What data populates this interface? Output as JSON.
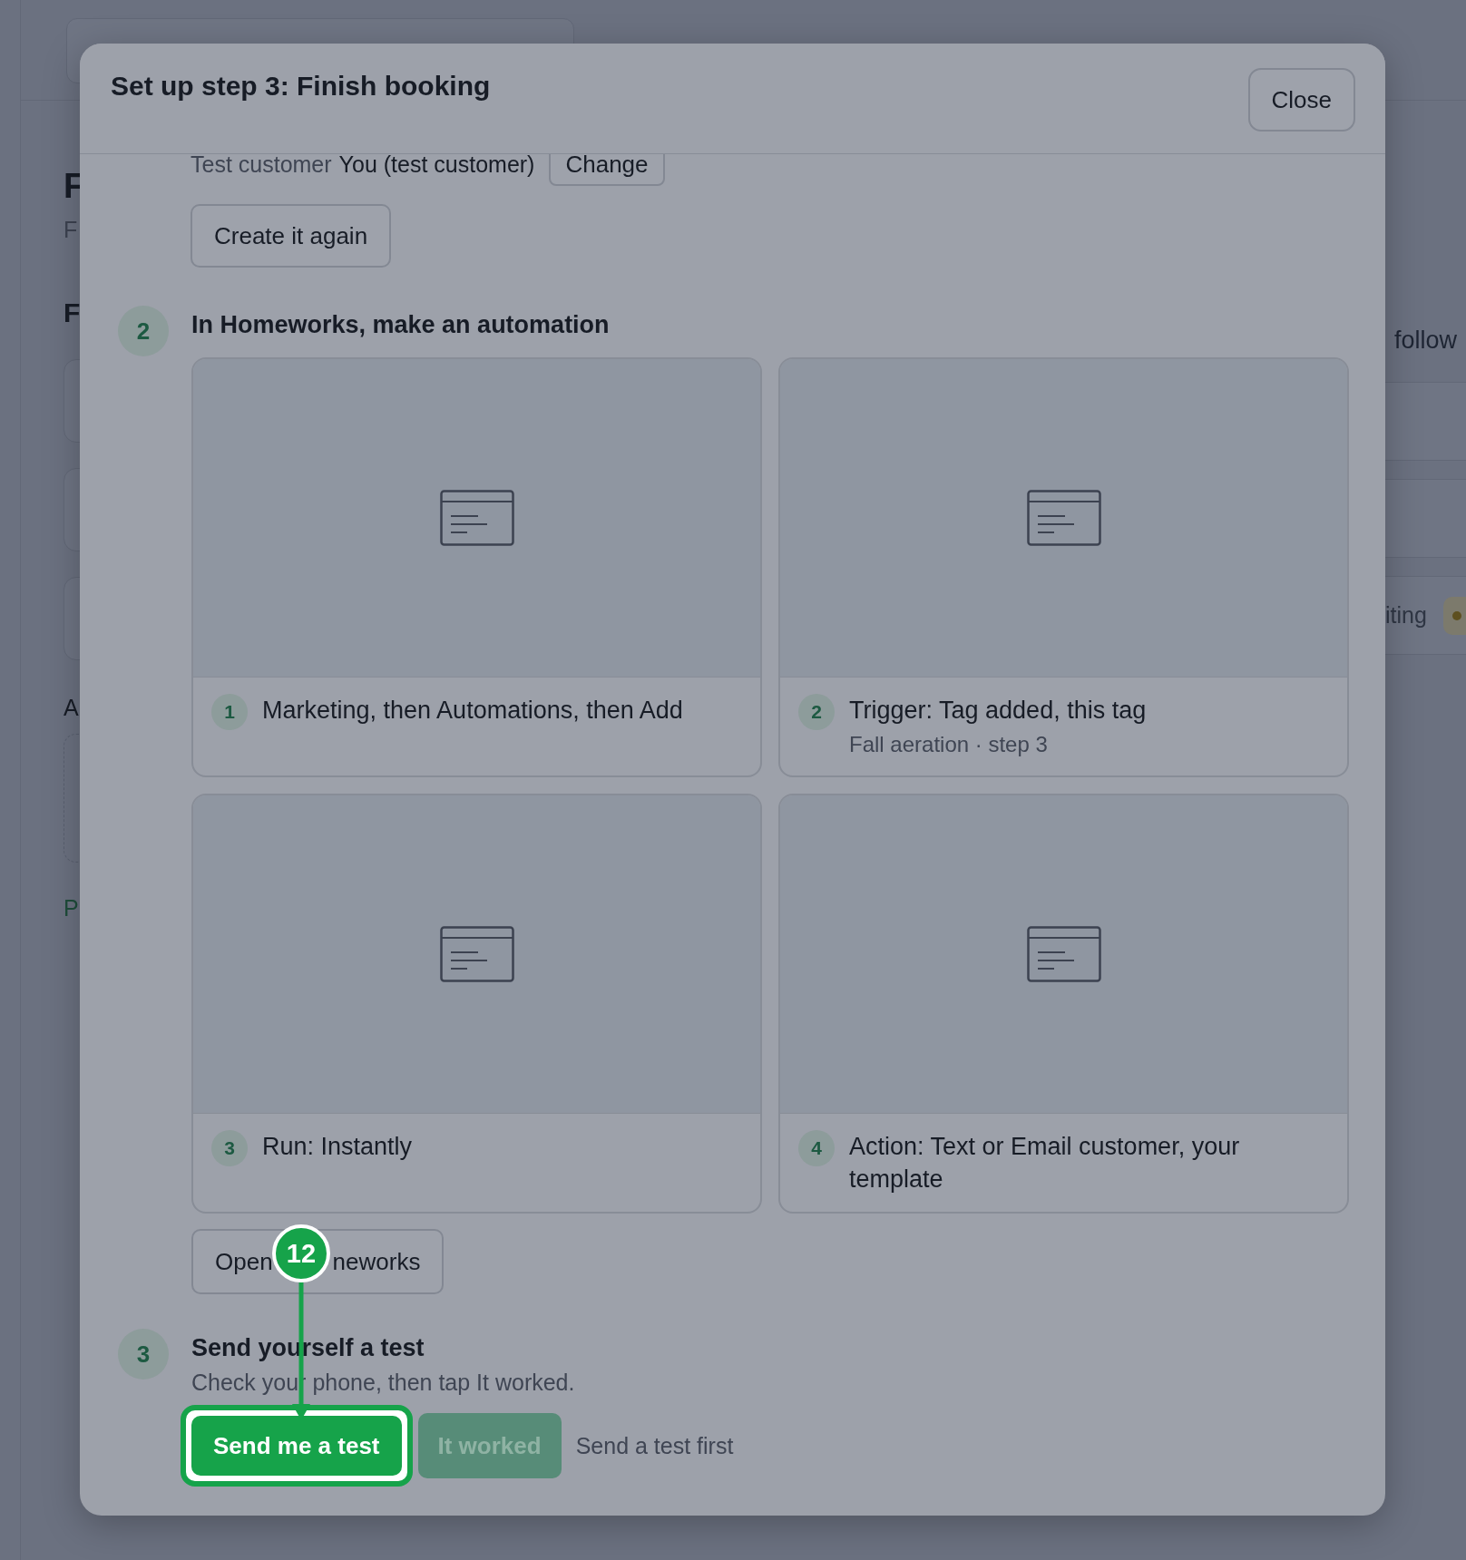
{
  "background": {
    "heading": "F",
    "subtitle": "F",
    "section": "F",
    "label": "A",
    "link": "P",
    "right_text": "follow",
    "status_text": "iting"
  },
  "dialog": {
    "title": "Set up step 3: Finish booking",
    "close": "Close",
    "test_customer": {
      "label": "Test customer",
      "value": "You (test customer)",
      "change": "Change"
    },
    "create_again": "Create it again",
    "automation_step": {
      "number": "2",
      "title": "In Homeworks, make an automation",
      "cards": [
        {
          "number": "1",
          "text": "Marketing, then Automations, then Add"
        },
        {
          "number": "2",
          "text": "Trigger: Tag added, this tag",
          "subtext": "Fall aeration · step 3"
        },
        {
          "number": "3",
          "text": "Run: Instantly"
        },
        {
          "number": "4",
          "text": "Action: Text or Email customer, your template"
        }
      ],
      "button": {
        "label_parts": [
          "Open",
          "neworks"
        ]
      }
    },
    "test_step": {
      "number": "3",
      "title": "Send yourself a test",
      "description": "Check your phone, then tap It worked.",
      "primary": {
        "label": "Send me a test",
        "highlighted": true
      },
      "secondary": {
        "label": "It worked",
        "disabled": true
      },
      "hint": "Send a test first"
    }
  },
  "annotation": {
    "number": "12"
  }
}
